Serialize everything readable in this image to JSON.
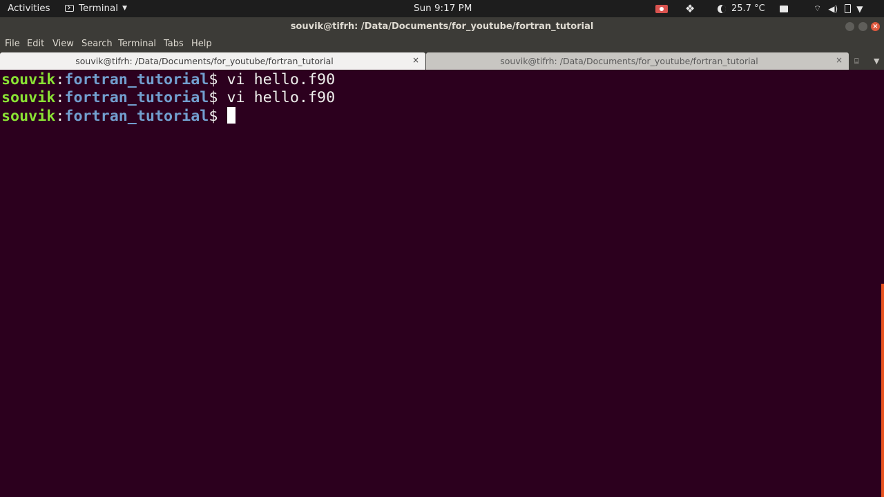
{
  "topbar": {
    "activities": "Activities",
    "app_menu": "Terminal",
    "clock": "Sun  9:17 PM",
    "temperature": "25.7 °C",
    "tray_icons": [
      "record-icon",
      "dropbox-icon",
      "weather-icon",
      "printer-icon",
      "wifi-icon",
      "volume-icon",
      "battery-icon",
      "power-menu-icon"
    ]
  },
  "window": {
    "title": "souvik@tifrh: /Data/Documents/for_youtube/fortran_tutorial"
  },
  "menu": {
    "items": [
      "File",
      "Edit",
      "View",
      "Search",
      "Terminal",
      "Tabs",
      "Help"
    ]
  },
  "tabs": [
    {
      "label": "souvik@tifrh: /Data/Documents/for_youtube/fortran_tutorial",
      "active": true
    },
    {
      "label": "souvik@tifrh: /Data/Documents/for_youtube/fortran_tutorial",
      "active": false
    }
  ],
  "terminal": {
    "lines": [
      {
        "user": "souvik",
        "sep": ":",
        "path": "fortran_tutorial",
        "prompt": "$ ",
        "command": "vi hello.f90"
      },
      {
        "user": "souvik",
        "sep": ":",
        "path": "fortran_tutorial",
        "prompt": "$ ",
        "command": "vi hello.f90"
      },
      {
        "user": "souvik",
        "sep": ":",
        "path": "fortran_tutorial",
        "prompt": "$ ",
        "command": ""
      }
    ]
  },
  "colors": {
    "terminal_bg": "#2c001e",
    "user_green": "#8ae234",
    "path_blue": "#729fcf",
    "accent_orange": "#e95420"
  }
}
